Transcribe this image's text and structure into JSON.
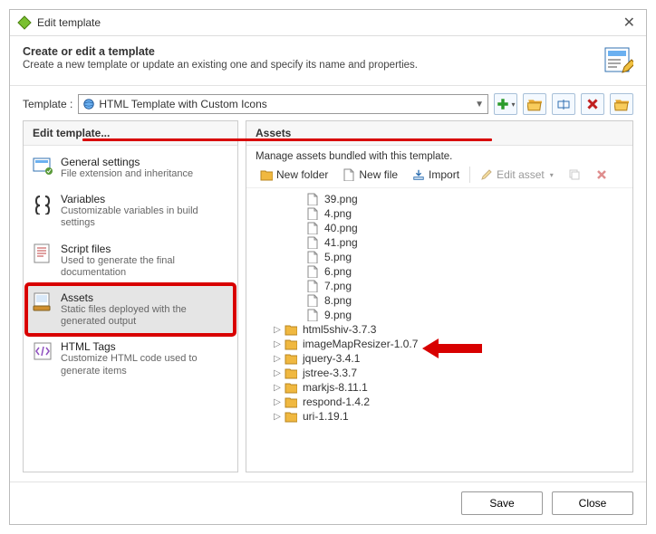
{
  "dialog_title": "Edit template",
  "header_title": "Create or edit a template",
  "header_subtitle": "Create a new template or update an existing one and specify its name and properties.",
  "template_label": "Template :",
  "template_value": "HTML Template with Custom Icons",
  "left_heading": "Edit template...",
  "right_heading": "Assets",
  "right_desc": "Manage assets bundled with this template.",
  "asset_toolbar": {
    "new_folder": "New folder",
    "new_file": "New file",
    "import": "Import",
    "edit_asset": "Edit asset"
  },
  "footer": {
    "save": "Save",
    "close": "Close"
  },
  "categories": [
    {
      "title": "General settings",
      "sub": "File extension and inheritance"
    },
    {
      "title": "Variables",
      "sub": "Customizable variables in build settings"
    },
    {
      "title": "Script files",
      "sub": "Used to generate the final documentation"
    },
    {
      "title": "Assets",
      "sub": "Static files deployed with the generated output"
    },
    {
      "title": "HTML Tags",
      "sub": "Customize HTML code used to generate items"
    }
  ],
  "file_list": [
    "39.png",
    "4.png",
    "40.png",
    "41.png",
    "5.png",
    "6.png",
    "7.png",
    "8.png",
    "9.png"
  ],
  "folders": [
    "html5shiv-3.7.3",
    "imageMapResizer-1.0.7",
    "jquery-3.4.1",
    "jstree-3.3.7",
    "markjs-8.11.1",
    "respond-1.4.2",
    "uri-1.19.1"
  ]
}
